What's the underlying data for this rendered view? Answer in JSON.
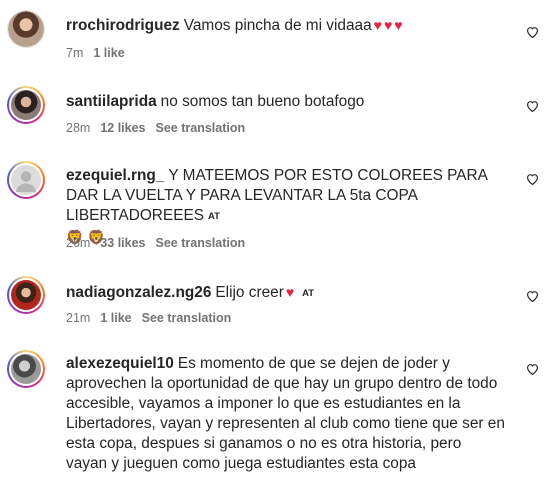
{
  "comments": [
    {
      "username": "rrochirodriguez",
      "text": "Vamos pincha de mi vidaaa",
      "emoji": [
        "♥",
        "♥",
        "♥"
      ],
      "time": "7m",
      "likes": "1 like",
      "translation": ""
    },
    {
      "username": "santiilaprida",
      "text": "no somos tan bueno botafogo",
      "time": "28m",
      "likes": "12 likes",
      "translation": "See translation"
    },
    {
      "username": "ezequiel.rng_",
      "text": "Y MATEEMOS POR ESTO COLOREES PARA DAR LA VUELTA Y PARA LEVANTAR LA 5ta COPA LIBERTADOREEES",
      "badge": "AT",
      "lions": [
        "🦁",
        "🦁"
      ],
      "time": "26m",
      "likes": "33 likes",
      "translation": "See translation"
    },
    {
      "username": "nadiagonzalez.ng26",
      "text": "Elijo creer",
      "emoji": [
        "♥"
      ],
      "badge": "AT",
      "time": "21m",
      "likes": "1 like",
      "translation": "See translation"
    },
    {
      "username": "alexezequiel10",
      "text": "Es momento de que se dejen de joder y aprovechen la oportunidad de que hay un grupo dentro de todo accesible, vayamos a imponer lo que es estudiantes en la Libertadores, vayan y representen al club como tiene que ser en esta copa, despues si ganamos o no es otra historia, pero vayan y jueguen como juega estudiantes esta copa"
    }
  ],
  "icons": {
    "like": "heart-outline-icon",
    "emoji_heart": "red-heart-icon",
    "emoji_lion": "lion-face-icon"
  },
  "colors": {
    "text": "#262626",
    "meta": "#737373",
    "heart_red": "#ed1f3f"
  }
}
